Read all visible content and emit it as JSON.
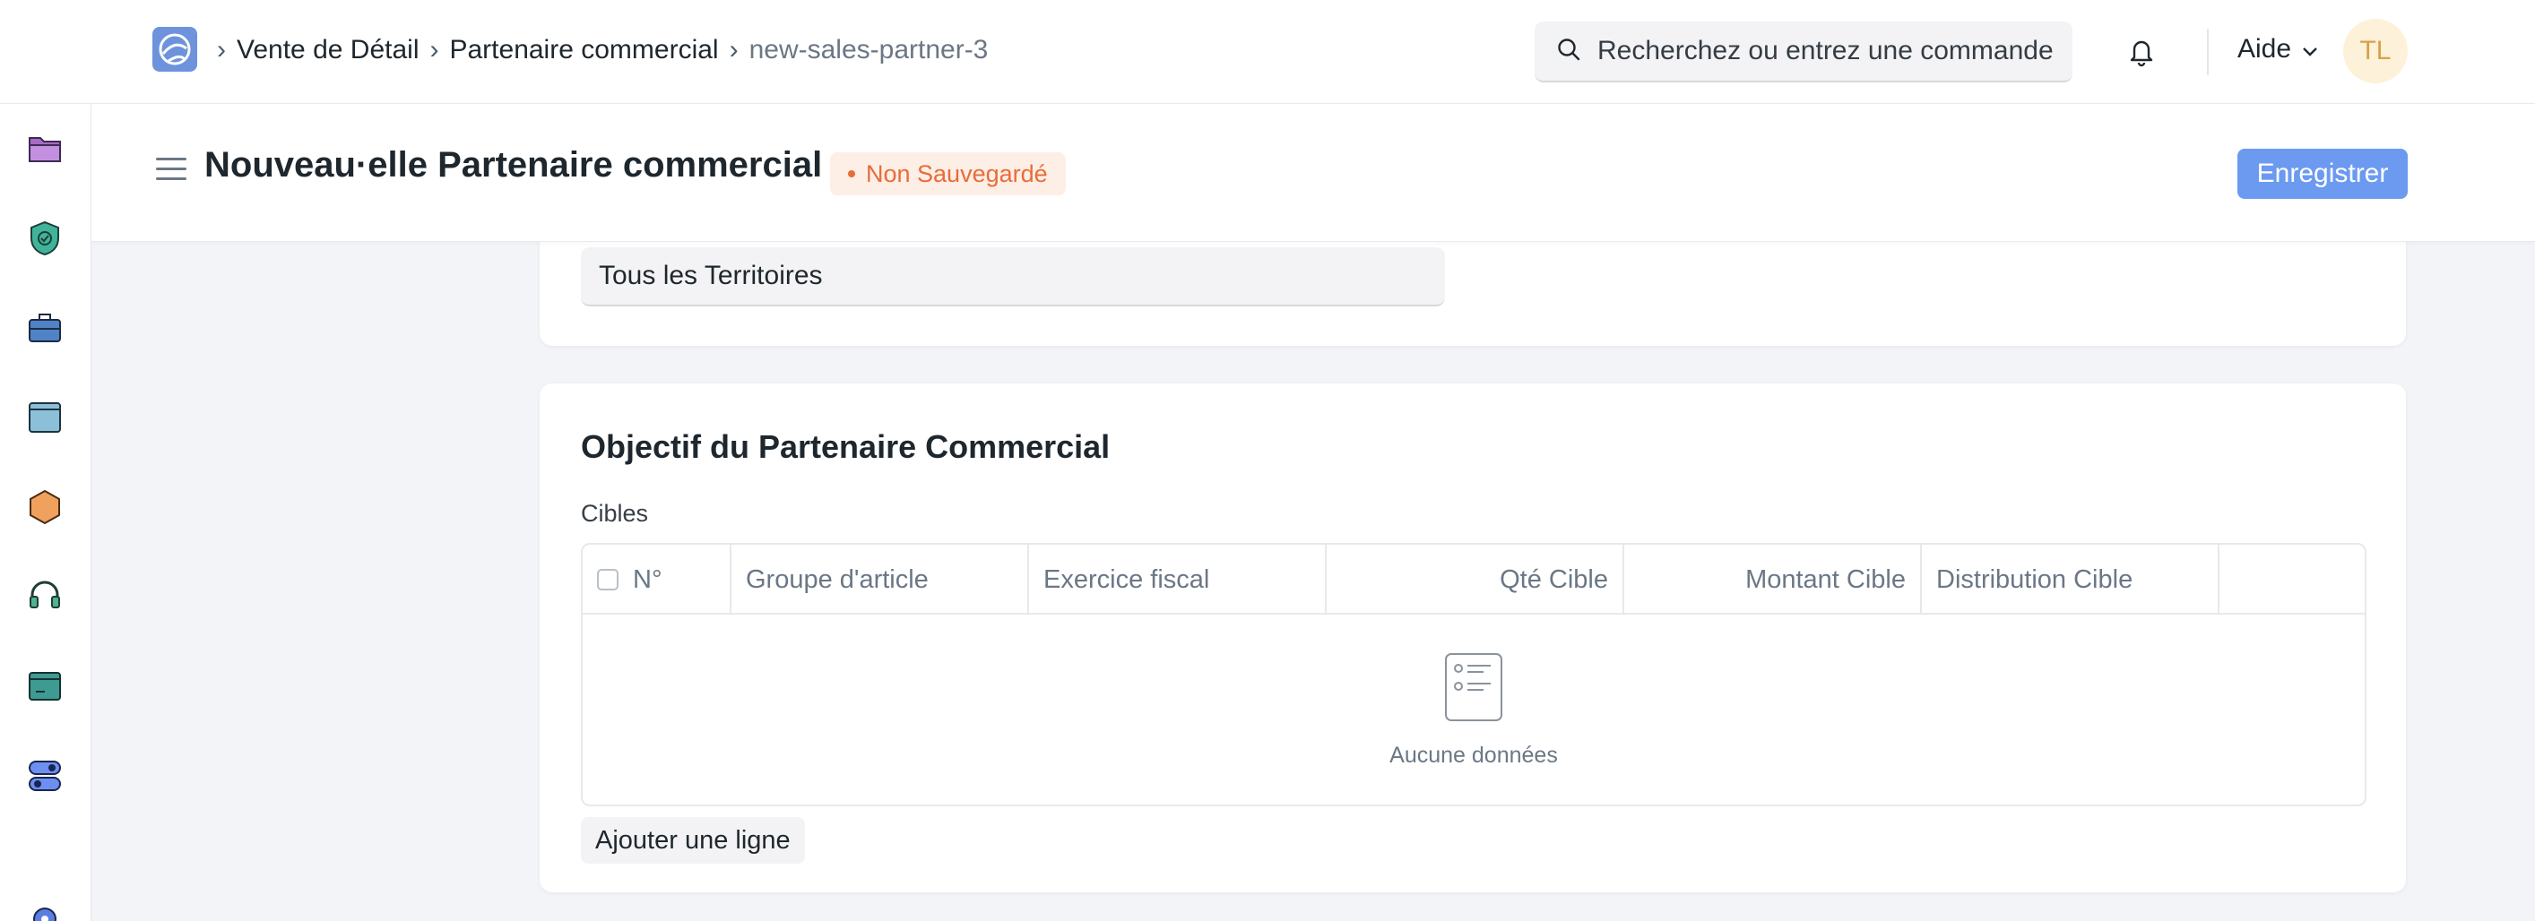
{
  "navbar": {
    "breadcrumbs": [
      "Vente de Détail",
      "Partenaire commercial",
      "new-sales-partner-3"
    ],
    "search_placeholder": "Recherchez ou entrez une commande",
    "help_label": "Aide",
    "avatar_initials": "TL"
  },
  "page": {
    "title": "Nouveau·elle Partenaire commercial",
    "status_badge": "Non Sauvegardé",
    "save_label": "Enregistrer"
  },
  "territory": {
    "value": "Tous les Territoires"
  },
  "targets_section": {
    "title": "Objectif du Partenaire Commercial",
    "table_label": "Cibles",
    "columns": [
      "N°",
      "Groupe d'article",
      "Exercice fiscal",
      "Qté Cible",
      "Montant Cible",
      "Distribution Cible"
    ],
    "empty_text": "Aucune données",
    "add_row_label": "Ajouter une ligne"
  },
  "sidebar": {
    "icons": [
      "folder-icon",
      "shield-check-icon",
      "briefcase-icon",
      "window-icon",
      "hexagon-icon",
      "headset-icon",
      "terminal-icon",
      "toggle-icon",
      "gear-icon"
    ]
  },
  "colors": {
    "primary": "#6b9af0",
    "unsaved": "#e86c3a",
    "avatar_bg": "#fdf1d9"
  }
}
